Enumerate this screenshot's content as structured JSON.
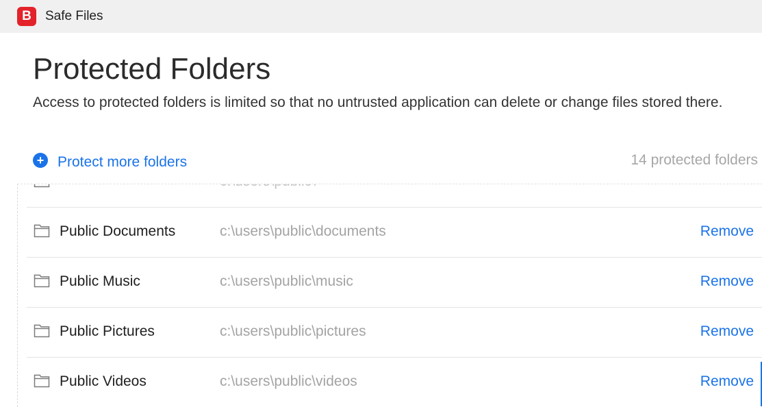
{
  "app": {
    "logo_letter": "B",
    "title": "Safe Files"
  },
  "page": {
    "title": "Protected Folders",
    "description": "Access to protected folders is limited so that no untrusted application can delete or change files stored there."
  },
  "actions": {
    "add_label": "Protect more folders",
    "count_label": "14 protected folders"
  },
  "partial_row": {
    "path": "c:\\users\\public\\"
  },
  "folders": [
    {
      "name": "Public Documents",
      "path": "c:\\users\\public\\documents",
      "remove": "Remove"
    },
    {
      "name": "Public Music",
      "path": "c:\\users\\public\\music",
      "remove": "Remove"
    },
    {
      "name": "Public Pictures",
      "path": "c:\\users\\public\\pictures",
      "remove": "Remove"
    },
    {
      "name": "Public Videos",
      "path": "c:\\users\\public\\videos",
      "remove": "Remove"
    }
  ],
  "icons": {
    "logo": "bitdefender-logo-icon",
    "add": "plus-circle-icon",
    "folder": "folder-icon"
  },
  "colors": {
    "brand_red": "#e3222a",
    "link_blue": "#1a73e8",
    "muted_text": "#a3a3a3"
  }
}
